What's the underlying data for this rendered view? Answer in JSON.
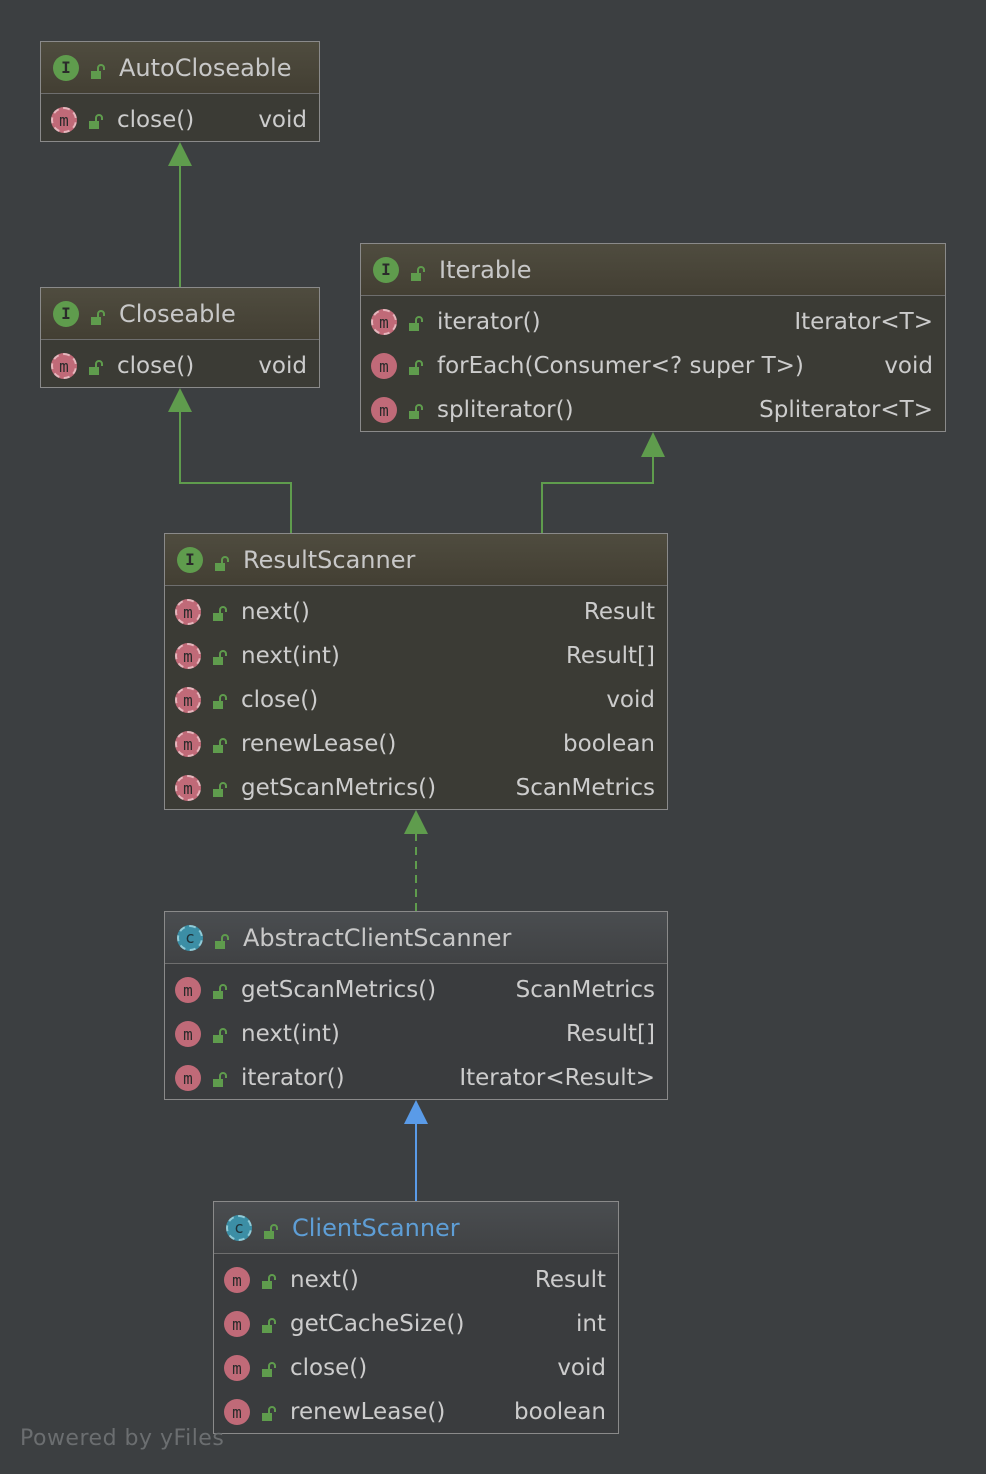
{
  "nodes": {
    "autocloseable": {
      "kind": "I",
      "title": "AutoCloseable",
      "members": [
        {
          "badge": "m",
          "name": "close()",
          "type": "void"
        }
      ]
    },
    "closeable": {
      "kind": "I",
      "title": "Closeable",
      "members": [
        {
          "badge": "m",
          "name": "close()",
          "type": "void"
        }
      ]
    },
    "iterable": {
      "kind": "I",
      "title": "Iterable",
      "members": [
        {
          "badge": "m",
          "name": "iterator()",
          "type": "Iterator<T>"
        },
        {
          "badge": "m",
          "name": "forEach(Consumer<? super T>)",
          "type": "void"
        },
        {
          "badge": "m",
          "name": "spliterator()",
          "type": "Spliterator<T>"
        }
      ]
    },
    "resultscanner": {
      "kind": "I",
      "title": "ResultScanner",
      "members": [
        {
          "badge": "m",
          "name": "next()",
          "type": "Result"
        },
        {
          "badge": "m",
          "name": "next(int)",
          "type": "Result[]"
        },
        {
          "badge": "m",
          "name": "close()",
          "type": "void"
        },
        {
          "badge": "m",
          "name": "renewLease()",
          "type": "boolean"
        },
        {
          "badge": "m",
          "name": "getScanMetrics()",
          "type": "ScanMetrics"
        }
      ]
    },
    "abstractclientscanner": {
      "kind": "C",
      "title": "AbstractClientScanner",
      "members": [
        {
          "badge": "m",
          "name": "getScanMetrics()",
          "type": "ScanMetrics"
        },
        {
          "badge": "m",
          "name": "next(int)",
          "type": "Result[]"
        },
        {
          "badge": "m",
          "name": "iterator()",
          "type": "Iterator<Result>"
        }
      ]
    },
    "clientscanner": {
      "kind": "C",
      "title": "ClientScanner",
      "members": [
        {
          "badge": "m",
          "name": "next()",
          "type": "Result"
        },
        {
          "badge": "m",
          "name": "getCacheSize()",
          "type": "int"
        },
        {
          "badge": "m",
          "name": "close()",
          "type": "void"
        },
        {
          "badge": "m",
          "name": "renewLease()",
          "type": "boolean"
        }
      ]
    }
  },
  "colors": {
    "background": "#3c3f41",
    "extends_edge": "#5f9c4d",
    "class_extends_edge": "#5a9be8",
    "selected_title": "#5e9ed6"
  },
  "watermark": "Powered by yFiles"
}
